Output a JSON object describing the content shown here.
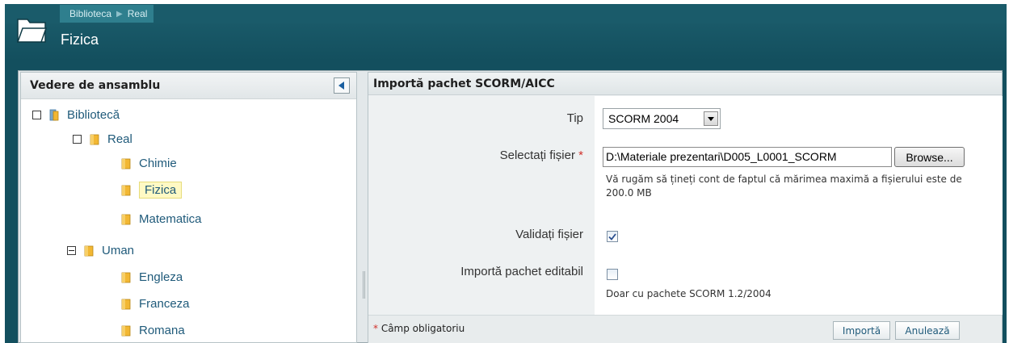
{
  "header": {
    "breadcrumb": [
      "Biblioteca",
      "Real"
    ],
    "title": "Fizica",
    "icon": "folder-open-icon"
  },
  "sidebar": {
    "title": "Vedere de ansamblu",
    "collapse_icon": "chevron-left-icon",
    "tree": {
      "root": "Bibliotecă",
      "real": "Real",
      "chimie": "Chimie",
      "fizica": "Fizica",
      "matematica": "Matematica",
      "uman": "Uman",
      "engleza": "Engleza",
      "franceza": "Franceza",
      "romana": "Romana"
    }
  },
  "form": {
    "title": "Importă pachet SCORM/AICC",
    "tip_label": "Tip",
    "tip_value": "SCORM 2004",
    "file_label": "Selectați fișier",
    "required_mark": "*",
    "file_value": "D:\\Materiale prezentari\\D005_L0001_SCORM",
    "browse_label": "Browse...",
    "file_help": "Vă rugăm să țineți cont de faptul că mărimea maximă a fișierului este de 200.0 MB",
    "validate_label": "Validați fișier",
    "validate_checked": true,
    "editable_label": "Importă pachet editabil",
    "editable_checked": false,
    "editable_help": "Doar cu pachete SCORM 1.2/2004",
    "required_note": "Câmp obligatoriu",
    "import_button": "Importă",
    "cancel_button": "Anulează"
  },
  "colors": {
    "header_bg": "#134f5e",
    "breadcrumb_bg": "#2f7f8e",
    "link": "#1f5a7a",
    "required": "#d0302b",
    "selected_bg": "#fff9c4",
    "folder": "#f2b733"
  }
}
